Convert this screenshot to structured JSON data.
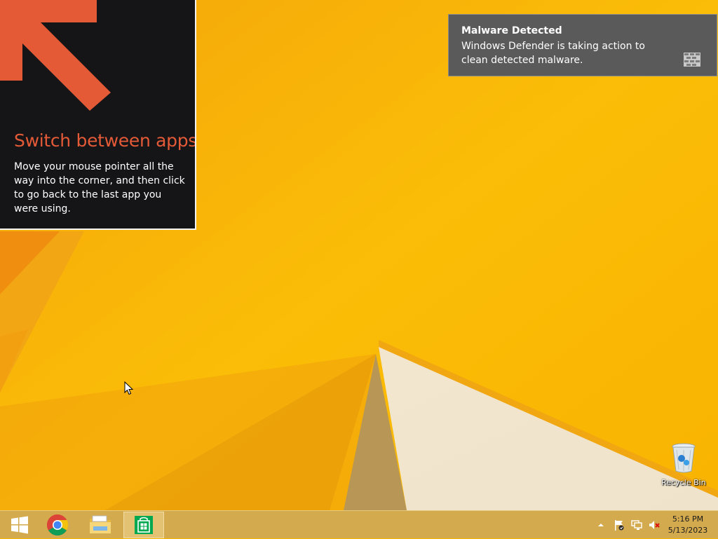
{
  "tip": {
    "title": "Switch between apps",
    "body": "Move your mouse pointer all the way into the corner, and then click to go back to the last app you were using."
  },
  "toast": {
    "title": "Malware Detected",
    "body": "Windows Defender is taking action to clean detected malware.",
    "icon": "windows-defender-wall-icon"
  },
  "desktop": {
    "icons": [
      {
        "label": "Recycle Bin",
        "icon": "recycle-bin-icon"
      }
    ]
  },
  "taskbar": {
    "start_icon": "windows-start-icon",
    "apps": [
      {
        "name": "Google Chrome",
        "icon": "chrome-icon"
      },
      {
        "name": "File Explorer",
        "icon": "file-explorer-icon"
      },
      {
        "name": "Store",
        "icon": "store-icon",
        "active": true
      }
    ],
    "tray_icons": [
      "show-hidden-icons-chevron",
      "action-center-flag-icon",
      "network-icon",
      "volume-muted-icon"
    ],
    "time": "5:16 PM",
    "date": "5/13/2023"
  },
  "colors": {
    "wallpaper": "#f7b500",
    "tip_accent": "#e45a37",
    "tip_background": "#151518",
    "toast_background": "#5a5a5a",
    "taskbar": "#d4aa4e"
  }
}
